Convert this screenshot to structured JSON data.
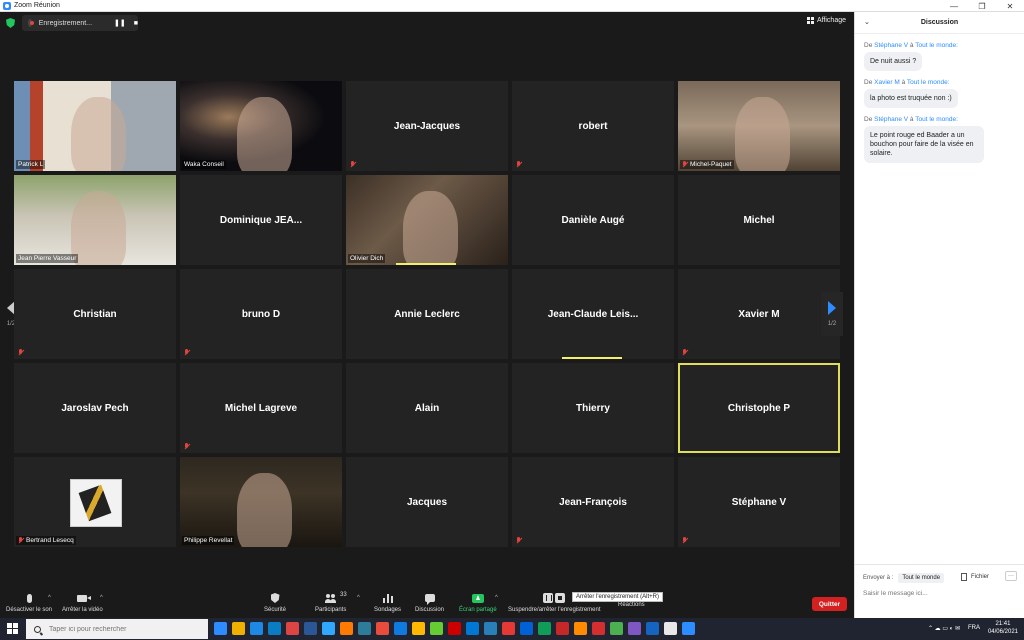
{
  "window": {
    "title": "Zoom Réunion"
  },
  "recording": {
    "label": "Enregistrement..."
  },
  "view_button": "Affichage",
  "page_indicator": "1/2",
  "tiles": [
    {
      "name": "Patrick L",
      "video": "v1",
      "muted": false
    },
    {
      "name": "Waka Conseil",
      "video": "v2",
      "muted": false
    },
    {
      "name": "Jean-Jacques",
      "video": "",
      "muted": true
    },
    {
      "name": "robert",
      "video": "",
      "muted": true
    },
    {
      "name": "Michel-Paquet",
      "video": "v4",
      "muted": true
    },
    {
      "name": "Jean Pierre Vasseur",
      "video": "v6",
      "muted": false
    },
    {
      "name": "Dominique  JEA...",
      "video": "",
      "muted": false
    },
    {
      "name": "Olivier Dich",
      "video": "v5",
      "muted": false
    },
    {
      "name": "Danièle Augé",
      "video": "",
      "muted": false
    },
    {
      "name": "Michel",
      "video": "",
      "muted": false
    },
    {
      "name": "Christian",
      "video": "",
      "muted": true
    },
    {
      "name": "bruno D",
      "video": "",
      "muted": true
    },
    {
      "name": "Annie Leclerc",
      "video": "",
      "muted": false
    },
    {
      "name": "Jean-Claude  Leis...",
      "video": "",
      "muted": false
    },
    {
      "name": "Xavier M",
      "video": "",
      "muted": true
    },
    {
      "name": "Jaroslav Pech",
      "video": "",
      "muted": false
    },
    {
      "name": "Michel Lagreve",
      "video": "",
      "muted": true
    },
    {
      "name": "Alain",
      "video": "",
      "muted": false
    },
    {
      "name": "Thierry",
      "video": "",
      "muted": false
    },
    {
      "name": "Christophe P",
      "video": "",
      "muted": false,
      "active": true
    },
    {
      "name": "Bertrand Lesecq",
      "video": "thumb",
      "muted": true
    },
    {
      "name": "Philippe Revellat",
      "video": "v3",
      "muted": false
    },
    {
      "name": "Jacques",
      "video": "",
      "muted": false
    },
    {
      "name": "Jean-François",
      "video": "",
      "muted": true
    },
    {
      "name": "Stéphane V",
      "video": "",
      "muted": true
    }
  ],
  "toolbar": {
    "mute": "Désactiver le son",
    "video": "Arrêter la vidéo",
    "security": "Sécurité",
    "participants": "Participants",
    "participants_count": "33",
    "polls": "Sondages",
    "chat": "Discussion",
    "share": "Écran partagé",
    "record": "Suspendre/arrêter l'enregistrement",
    "record_tooltip": "Arrêter l'enregistrement (Alt+R)",
    "reactions": "Réactions",
    "quit": "Quitter"
  },
  "chat": {
    "title": "Discussion",
    "messages": [
      {
        "de": "De",
        "from": "Stéphane V",
        "a": "à",
        "to": "Tout le monde",
        "text": "De nuit aussi ?"
      },
      {
        "de": "De",
        "from": "Xavier M",
        "a": "à",
        "to": "Tout le monde",
        "text": "la photo est truquée non :)"
      },
      {
        "de": "De",
        "from": "Stéphane V",
        "a": "à",
        "to": "Tout le monde",
        "text": "Le point rouge ed Baader a un bouchon pour faire de la visée en solaire."
      }
    ],
    "send_to_label": "Envoyer à :",
    "send_to_value": "Tout le monde",
    "file_label": "Fichier",
    "more_label": "···",
    "input_placeholder": "Saisir le message ici..."
  },
  "taskbar": {
    "search_placeholder": "Taper ici pour rechercher",
    "lang": "FRA",
    "time": "21:41",
    "date": "04/06/2021",
    "app_colors": [
      "#2d8cff",
      "#f0b000",
      "#1e88e5",
      "#0a7cc2",
      "#d44",
      "#2b5797",
      "#31a8ff",
      "#ff7a00",
      "#2d7d9a",
      "#e74c3c",
      "#0f7bde",
      "#ffb900",
      "#6c3",
      "#c00",
      "#0078d4",
      "#2980b9",
      "#e53935",
      "#0061d5",
      "#0f9d58",
      "#c62828",
      "#ff8c00",
      "#d32f2f",
      "#4caf50",
      "#7e57c2",
      "#1565c0",
      "#e8e8e8",
      "#2d8cff"
    ]
  },
  "colors": {
    "accent": "#2d8cff",
    "active_speaker": "#dede5a",
    "quit": "#d32020",
    "share": "#23c55e"
  }
}
